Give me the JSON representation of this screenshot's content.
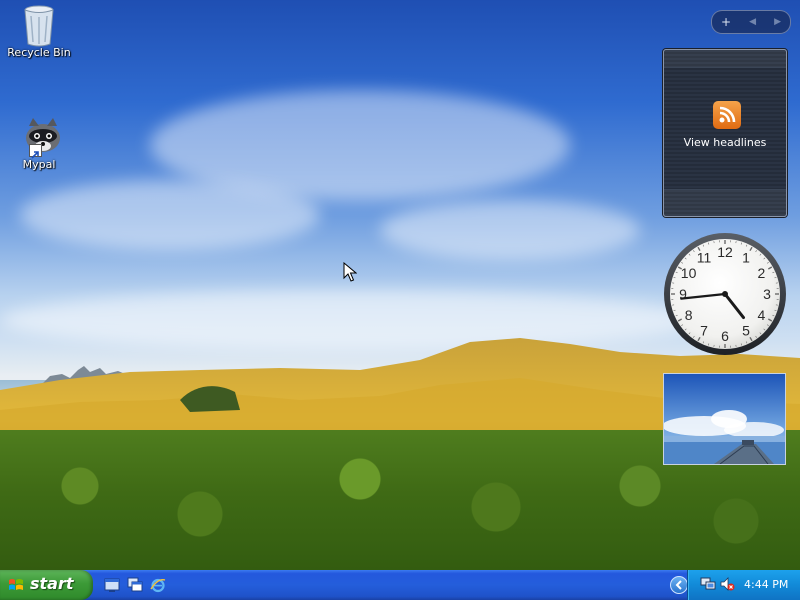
{
  "desktop": {
    "icons": [
      {
        "label": "Recycle Bin"
      },
      {
        "label": "Mypal"
      }
    ]
  },
  "sidebar": {
    "toolbar": {
      "add": "+",
      "prev": "◀",
      "next": "▶"
    },
    "feed_gadget": {
      "label": "View headlines",
      "icon": "rss-icon"
    },
    "clock_gadget": {
      "numerals": [
        "12",
        "1",
        "2",
        "3",
        "4",
        "5",
        "6",
        "7",
        "8",
        "9",
        "10",
        "11"
      ],
      "time": "4:44"
    },
    "slideshow_gadget": {
      "icon": "slideshow-image"
    }
  },
  "taskbar": {
    "start_label": "start",
    "quick_launch": [
      "show-desktop-icon",
      "window-switcher-icon",
      "internet-explorer-icon"
    ],
    "tray": {
      "expand_icon": "chevron-left-icon",
      "icons": [
        "network-icon",
        "volume-muted-icon"
      ],
      "clock": "4:44 PM"
    }
  },
  "colors": {
    "taskbar_blue": "#245edb",
    "start_green": "#3c9a37",
    "tray_blue": "#128ad8",
    "rss_orange": "#f08a24"
  }
}
